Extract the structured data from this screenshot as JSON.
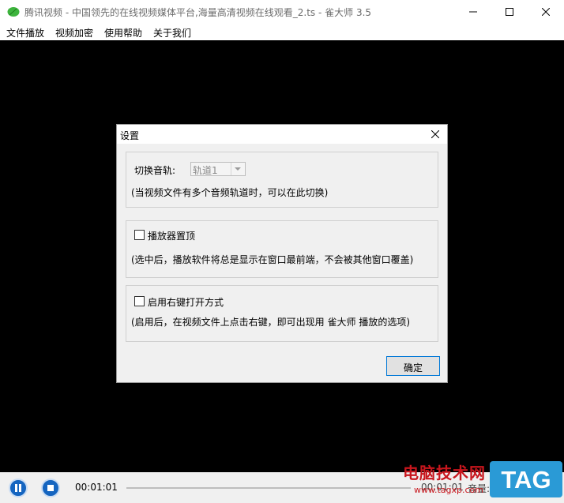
{
  "window": {
    "title": "腾讯视频 - 中国领先的在线视频媒体平台,海量高清视频在线观看_2.ts - 雀大师 3.5",
    "icon": "leaf-icon",
    "controls": [
      "minimize-icon",
      "maximize-icon",
      "close-icon"
    ]
  },
  "menu": {
    "items": [
      {
        "label": "文件播放"
      },
      {
        "label": "视频加密"
      },
      {
        "label": "使用帮助"
      },
      {
        "label": "关于我们"
      }
    ]
  },
  "dialog": {
    "title": "设置",
    "audio_track": {
      "label": "切换音轨:",
      "selected": "轨道1",
      "hint": "(当视频文件有多个音频轨道时，可以在此切换)"
    },
    "topmost": {
      "label": "播放器置顶",
      "checked": false,
      "hint": "(选中后，播放软件将总是显示在窗口最前端，不会被其他窗口覆盖)"
    },
    "context_menu": {
      "label": "启用右键打开方式",
      "checked": false,
      "hint": "(启用后，在视频文件上点击右键，即可出现用 雀大师 播放的选项)"
    },
    "ok_label": "确定"
  },
  "player": {
    "current_time": "00:01:01",
    "right_time": "00:01:01",
    "volume_label": "音量:",
    "buttons": [
      "pause-icon",
      "stop-icon"
    ]
  },
  "watermark": {
    "text": "电脑技术网",
    "url": "www.tagxp.com",
    "tag": "TAG"
  },
  "colors": {
    "accent": "#0078d7",
    "player_button": "#1565c0",
    "watermark_red": "#c8161d",
    "watermark_blue": "#2a9ad6"
  }
}
